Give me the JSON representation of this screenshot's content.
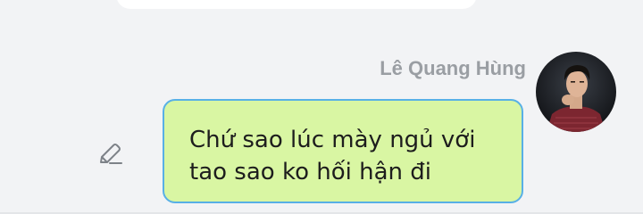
{
  "chat": {
    "message": {
      "sender_name": "Lê Quang Hùng",
      "text": "Chứ sao lúc mày ngủ với tao sao ko hối hận đi",
      "bubble_color": "#d9f6a3",
      "bubble_border_color": "#58b0e6"
    },
    "icons": {
      "edit": "pencil-icon",
      "avatar": "user-avatar"
    },
    "colors": {
      "background": "#f2f3f5",
      "name_text": "#9a9ea3"
    }
  }
}
